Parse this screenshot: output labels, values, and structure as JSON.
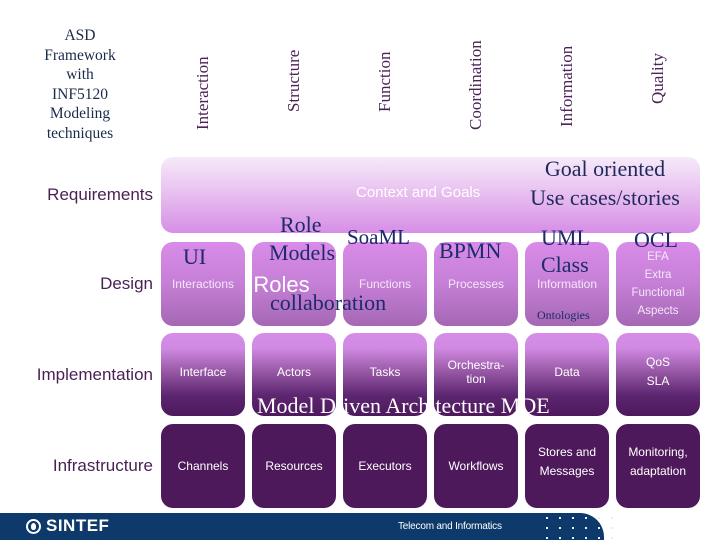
{
  "title": "ASD Framework with INF5120 Modeling techniques",
  "title_lines": [
    "ASD",
    "Framework",
    "with",
    "INF5120",
    "Modeling",
    "techniques"
  ],
  "columns": [
    "Interaction",
    "Structure",
    "Function",
    "Coordination",
    "Information",
    "Quality"
  ],
  "rows": {
    "requirements": "Requirements",
    "design": "Design",
    "implementation": "Implementation",
    "infrastructure": "Infrastructure"
  },
  "requirements_box": {
    "label": "Context and Goals",
    "overlay_lines": [
      "Goal oriented",
      "Use cases/stories"
    ]
  },
  "design_cells": [
    {
      "label": "Interactions"
    },
    {
      "label": "Roles"
    },
    {
      "label": "Functions"
    },
    {
      "label": "Processes"
    },
    {
      "label": "Information",
      "sub": "Ontologies"
    },
    {
      "lines": [
        "EFA",
        "Extra",
        "Functional",
        "Aspects"
      ]
    }
  ],
  "design_overlays": {
    "ui": "UI",
    "role_models_1": "Role",
    "role_models_2": "Models",
    "collaboration": "collaboration",
    "soaml": "SoaML",
    "bpmn": "BPMN",
    "uml_1": "UML",
    "uml_2": "Class",
    "ocl": "OCL"
  },
  "implementation_cells": [
    {
      "lines": [
        "Interface"
      ]
    },
    {
      "lines": [
        "Actors"
      ]
    },
    {
      "lines": [
        "Tasks"
      ]
    },
    {
      "lines": [
        "Orchestra-",
        "tion"
      ]
    },
    {
      "lines": [
        "Data"
      ]
    },
    {
      "lines": [
        "QoS",
        "SLA"
      ]
    }
  ],
  "mda_overlay": "Model Driven Architecture MDE",
  "infrastructure_cells": [
    {
      "lines": [
        "Channels"
      ]
    },
    {
      "lines": [
        "Resources"
      ]
    },
    {
      "lines": [
        "Executors"
      ]
    },
    {
      "lines": [
        "Workflows"
      ]
    },
    {
      "lines": [
        "Stores and",
        "Messages"
      ]
    },
    {
      "lines": [
        "Monitoring,",
        "adaptation"
      ]
    }
  ],
  "footer": {
    "logo_text": "SINTEF",
    "department": "Telecom and Informatics"
  },
  "colors": {
    "dark_purple": "#4e195b",
    "light_purple": "#d98ce8",
    "footer_blue": "#0d3a6a",
    "overlay_navy": "#1d2a6b"
  }
}
